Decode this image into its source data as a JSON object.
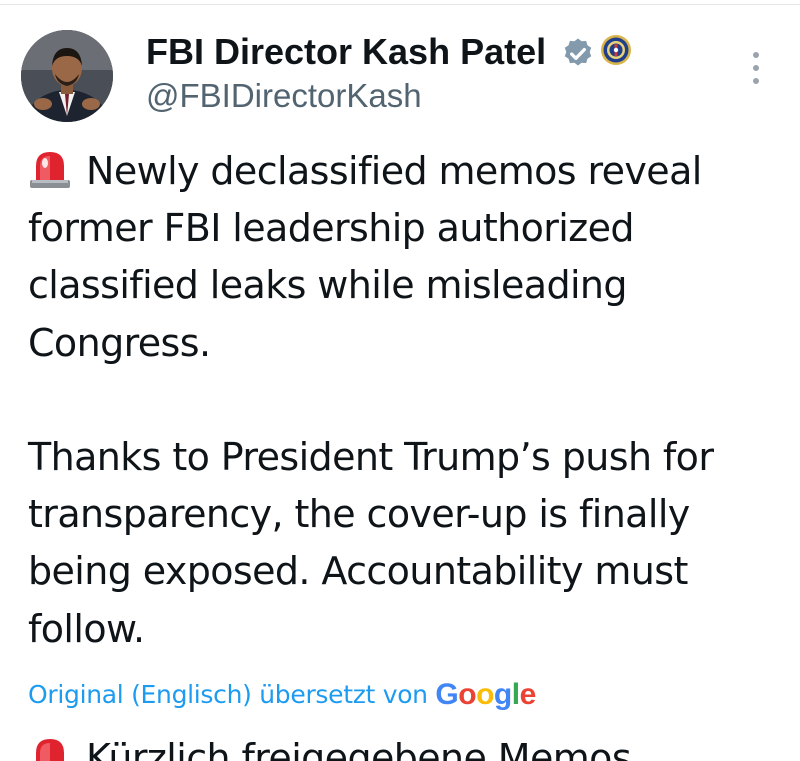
{
  "tweet": {
    "author": {
      "display_name": "FBI Director Kash Patel",
      "handle": "@FBIDirectorKash",
      "badges": [
        "verified-badge-icon",
        "fbi-seal-icon"
      ]
    },
    "menu_icon": "more-vertical-icon",
    "text_lines": [
      "Newly declassified memos reveal",
      "former FBI leadership authorized",
      "classified leaks while misleading",
      "Congress.",
      "",
      "Thanks to President Trump’s push for",
      "transparency, the cover-up is finally",
      "being exposed. Accountability must",
      "follow."
    ],
    "leading_emoji": "siren-icon",
    "translation": {
      "label": "Original (Englisch) übersetzt von",
      "provider_letters": [
        "G",
        "o",
        "o",
        "g",
        "l",
        "e"
      ]
    },
    "translated_text_start": "Kürzlich freigegebene Memos"
  },
  "colors": {
    "text_primary": "#0f1419",
    "text_secondary": "#536471",
    "link": "#1d9bf0",
    "verified_badge": "#829aab"
  }
}
